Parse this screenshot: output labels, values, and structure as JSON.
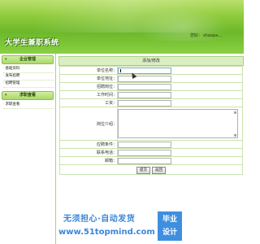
{
  "header": {
    "site_title": "大学生兼职系统",
    "user_label": "您好：",
    "user_name": "shaopa..."
  },
  "sidebar": {
    "groups": [
      {
        "title": "企业管理",
        "items": [
          "基础资料",
          "发布招聘",
          "招聘管理"
        ]
      },
      {
        "title": "求职查看",
        "items": [
          "求职查看"
        ]
      }
    ]
  },
  "form": {
    "title": "添加/修改",
    "fields": [
      {
        "label": "单位名称：",
        "value": ""
      },
      {
        "label": "单位地址：",
        "value": ""
      },
      {
        "label": "招聘岗位：",
        "value": ""
      },
      {
        "label": "工作时间：",
        "value": ""
      },
      {
        "label": "工资：",
        "value": ""
      },
      {
        "label": "岗位介绍：",
        "value": ""
      },
      {
        "label": "应聘条件：",
        "value": ""
      },
      {
        "label": "联系电话：",
        "value": ""
      },
      {
        "label": "邮箱：",
        "value": ""
      }
    ],
    "submit_label": "提交",
    "back_label": "返回"
  },
  "watermark": {
    "line1": "无须担心·自动发货",
    "line2": "www.51topmind.com",
    "badge_top": "毕业",
    "badge_bottom": "设计"
  }
}
